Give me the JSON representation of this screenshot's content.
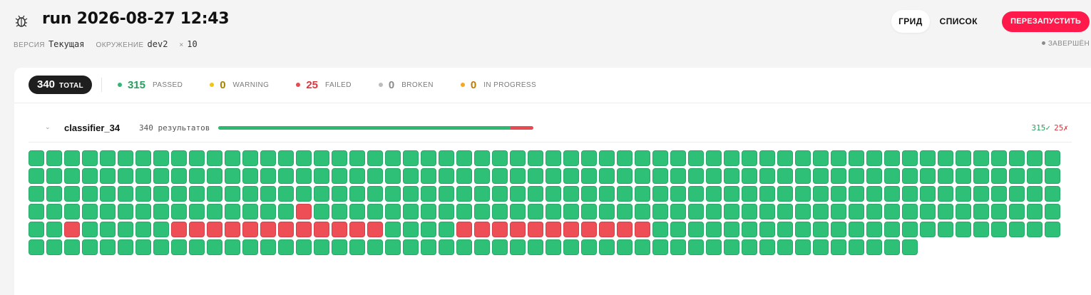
{
  "header": {
    "title": "run 2026-08-27 12:43",
    "logo_icon": "bug-icon",
    "version_label": "ВЕРСИЯ",
    "version_value": "Текущая",
    "env_label": "ОКРУЖЕНИЕ",
    "env_value": "dev2",
    "repeat_prefix": "×",
    "repeat_value": "10"
  },
  "view_switch": {
    "grid_label": "ГРИД",
    "list_label": "СПИСОК",
    "active": "grid"
  },
  "restart_button": "ПЕРЕЗАПУСТИТЬ",
  "status": "ЗАВЕРШЁН",
  "summary": {
    "total": {
      "value": "340",
      "label": "TOTAL"
    },
    "stats": [
      {
        "key": "passed",
        "value": "315",
        "label": "PASSED",
        "color": "#2fb872",
        "num_color": "#2a9c5e"
      },
      {
        "key": "warning",
        "value": "0",
        "label": "WARNING",
        "color": "#f2c414",
        "num_color": "#a88100"
      },
      {
        "key": "failed",
        "value": "25",
        "label": "FAILED",
        "color": "#e84a52",
        "num_color": "#d9363f"
      },
      {
        "key": "broken",
        "value": "0",
        "label": "BROKEN",
        "color": "#bdbdbd",
        "num_color": "#8a8a8a"
      },
      {
        "key": "in_progress",
        "value": "0",
        "label": "IN PROGRESS",
        "color": "#f5a623",
        "num_color": "#c07a00"
      }
    ]
  },
  "group": {
    "name": "classifier_34",
    "count_text": "340 результатов",
    "passed_text": "315✓",
    "failed_text": "25✗",
    "passed": 315,
    "failed": 25,
    "total": 340,
    "failed_positions": [
      189,
      234,
      240,
      241,
      242,
      243,
      244,
      245,
      246,
      247,
      248,
      249,
      250,
      251,
      256,
      257,
      258,
      259,
      260,
      261,
      262,
      263,
      264,
      265,
      266
    ]
  }
}
